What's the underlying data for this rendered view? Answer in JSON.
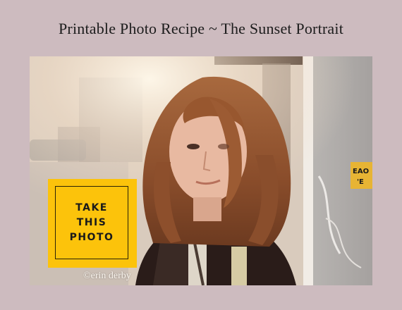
{
  "header": {
    "title": "Printable Photo Recipe ~ The Sunset Portrait"
  },
  "photo": {
    "subject": "backlit portrait of girl with long hair",
    "badge": {
      "line1": "TAKE",
      "line2": "THIS",
      "line3": "PHOTO",
      "color": "#fcc30b"
    },
    "credit": "©erin derby",
    "sticker_text": "EAO\n'E"
  },
  "colors": {
    "background": "#cdbbbf",
    "badge_yellow": "#fcc30b"
  }
}
